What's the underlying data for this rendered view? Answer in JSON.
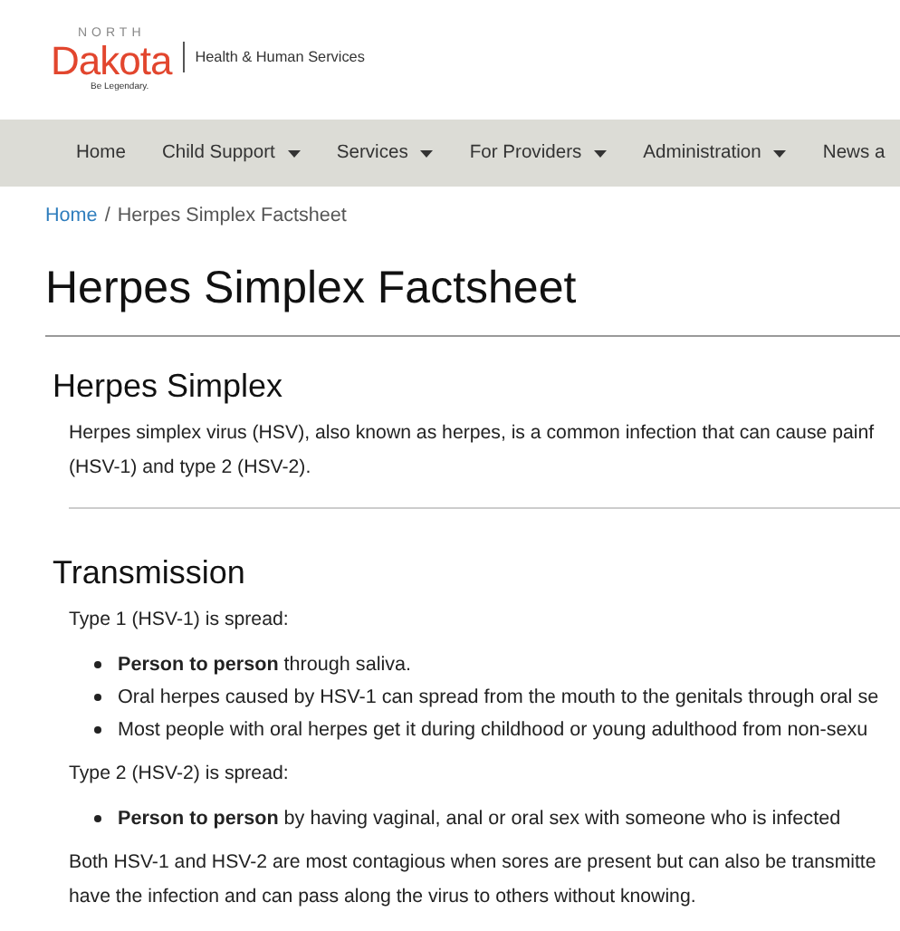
{
  "logo": {
    "top": "NORTH",
    "name": "Dakota",
    "tagline": "Be Legendary.",
    "department": "Health & Human Services"
  },
  "nav": [
    {
      "label": "Home",
      "dropdown": false
    },
    {
      "label": "Child Support",
      "dropdown": true
    },
    {
      "label": "Services",
      "dropdown": true
    },
    {
      "label": "For Providers",
      "dropdown": true
    },
    {
      "label": "Administration",
      "dropdown": true
    },
    {
      "label": "News a",
      "dropdown": false
    }
  ],
  "breadcrumb": {
    "link": "Home",
    "separator": "/",
    "current": "Herpes Simplex Factsheet"
  },
  "title": "Herpes Simplex Factsheet",
  "sections": [
    {
      "heading": "Herpes Simplex",
      "blocks": [
        {
          "kind": "paragraph",
          "text": "Herpes simplex virus (HSV), also known as herpes, is a common infection that can cause painf\n(HSV-1) and type 2 (HSV-2)."
        },
        {
          "kind": "divider"
        }
      ]
    },
    {
      "heading": "Transmission",
      "blocks": [
        {
          "kind": "paragraph",
          "text": "Type 1 (HSV-1) is spread:"
        },
        {
          "kind": "list",
          "items": [
            "**Person to person** through saliva.",
            "Oral herpes caused by HSV-1 can spread from the mouth to the genitals through oral se",
            "Most people with oral herpes get it during childhood or young adulthood from non-sexu"
          ]
        },
        {
          "kind": "paragraph",
          "text": "Type 2 (HSV-2) is spread:"
        },
        {
          "kind": "list",
          "items": [
            "**Person to person** by having vaginal, anal or oral sex with someone who is infected"
          ]
        },
        {
          "kind": "paragraph",
          "text": "Both HSV-1 and HSV-2 are most contagious when sores are present but can also be transmitte\nhave the infection and can pass along the virus to others without knowing."
        }
      ]
    }
  ]
}
